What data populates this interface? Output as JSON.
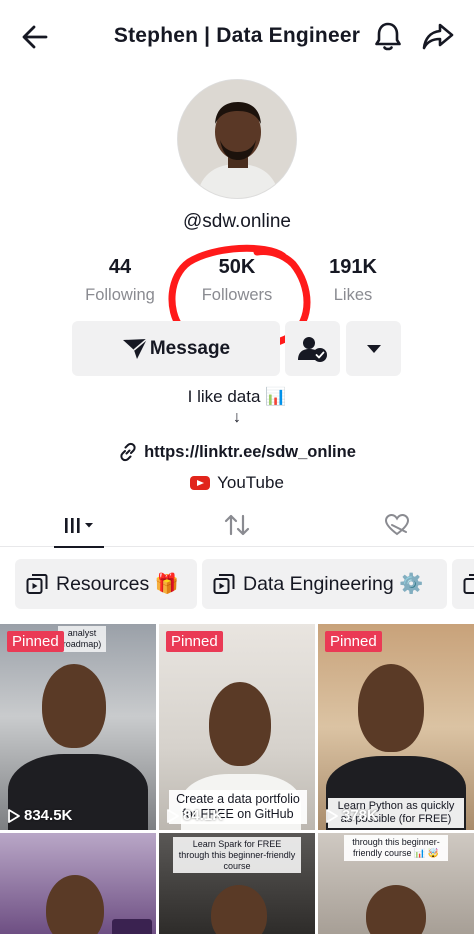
{
  "header": {
    "title": "Stephen | Data Engineer"
  },
  "profile": {
    "username": "@sdw.online",
    "stats": {
      "following": {
        "count": "44",
        "label": "Following"
      },
      "followers": {
        "count": "50K",
        "label": "Followers"
      },
      "likes": {
        "count": "191K",
        "label": "Likes"
      }
    },
    "message_label": "Message",
    "bio": "I like data 📊",
    "bio_arrow": "↓",
    "link": "https://linktr.ee/sdw_online",
    "youtube_label": "YouTube"
  },
  "playlists": [
    {
      "label": "Resources 🎁"
    },
    {
      "label": "Data Engineering ⚙️"
    }
  ],
  "videos": [
    {
      "pinned": "Pinned",
      "views": "834.5K",
      "caption": "analyst roadmap)"
    },
    {
      "pinned": "Pinned",
      "views": "84.1K",
      "caption": "Create a data portfolio for FREE on GitHub"
    },
    {
      "pinned": "Pinned",
      "views": "378K",
      "caption": "Learn Python as quickly as possible (for FREE)"
    },
    {
      "caption": "Learn Spark for FREE through this beginner-friendly course"
    },
    {
      "caption": "through this beginner-friendly course 📊 🤯"
    }
  ],
  "colors": {
    "pinned_badge": "#ea3a55",
    "annotation_circle": "#ff1a1a",
    "youtube_red": "#e1251b",
    "muted_text": "#8a8b91",
    "button_bg": "#f1f1f2"
  },
  "icons": [
    "back-arrow-icon",
    "bell-icon",
    "share-icon",
    "send-icon",
    "person-check-icon",
    "caret-down-icon",
    "link-icon",
    "youtube-icon",
    "grid-icon",
    "repost-icon",
    "liked-icon",
    "playlist-icon",
    "play-icon"
  ]
}
